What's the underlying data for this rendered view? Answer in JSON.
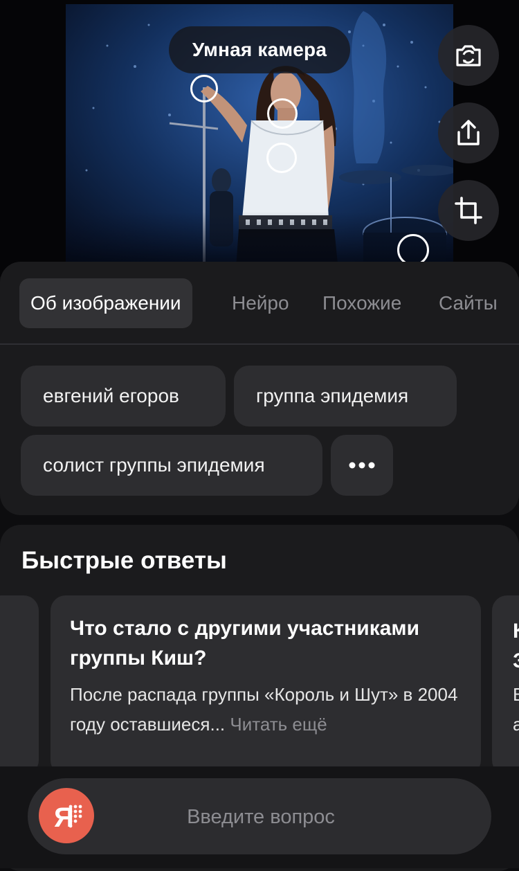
{
  "camera": {
    "title": "Умная камера",
    "actions": [
      {
        "name": "camera-button",
        "icon": "camera-icon"
      },
      {
        "name": "share-button",
        "icon": "share-icon"
      },
      {
        "name": "crop-button",
        "icon": "crop-icon"
      }
    ]
  },
  "tabs": [
    {
      "label": "Об изображении",
      "active": true
    },
    {
      "label": "Нейро",
      "active": false
    },
    {
      "label": "Похожие",
      "active": false
    },
    {
      "label": "Сайты",
      "active": false
    }
  ],
  "tags": {
    "items": [
      "евгений егоров",
      "группа эпидемия",
      "солист группы эпидемия"
    ],
    "more_icon": "more-dots-icon"
  },
  "quick_answers": {
    "title": "Быстрые ответы",
    "cards": [
      {
        "question": "Что стало с другими участниками группы Киш?",
        "answer": "После распада группы «Король и Шут» в 2004 году оставшиеся...",
        "more_label": "Читать ещё"
      },
      {
        "question_lines": [
          "К",
          "З"
        ],
        "answer_lines": [
          "В",
          "а"
        ]
      }
    ]
  },
  "ask": {
    "placeholder": "Введите вопрос",
    "logo_icon": "alice-logo-icon"
  },
  "colors": {
    "background": "#0d0d0f",
    "panel": "#1b1b1d",
    "chip": "#2d2d30",
    "muted_text": "#8d8d92",
    "alice_accent": "#e8614e"
  }
}
